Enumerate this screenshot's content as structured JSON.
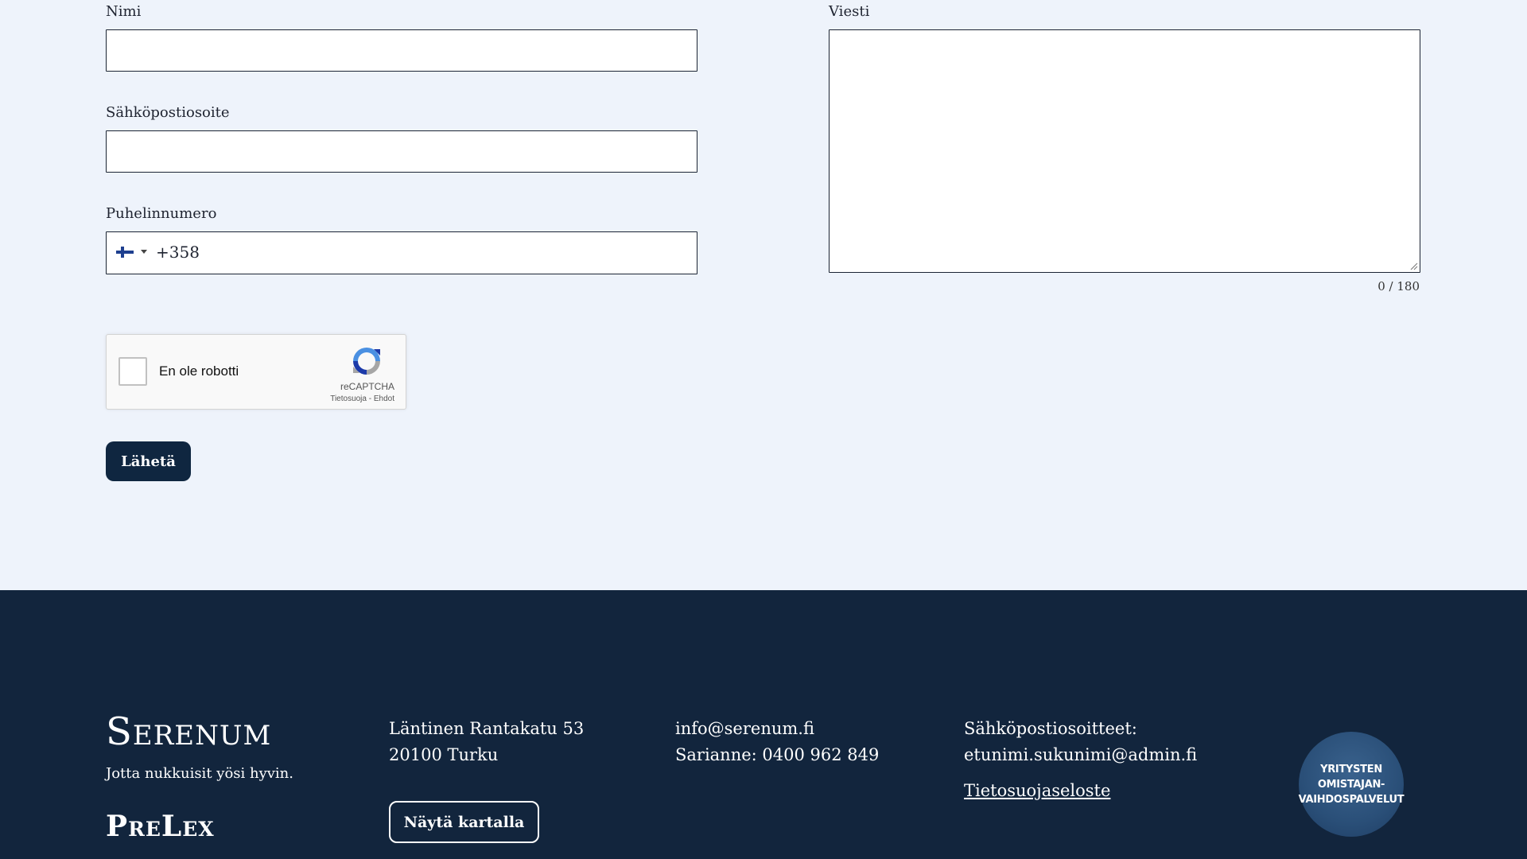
{
  "form": {
    "name_label": "Nimi",
    "email_label": "Sähköpostiosoite",
    "phone_label": "Puhelinnumero",
    "phone_prefix": "+358",
    "message_label": "Viesti",
    "char_counter": "0 / 180",
    "recaptcha": {
      "label": "En ole robotti",
      "brand": "reCAPTCHA",
      "links": "Tietosuoja - Ehdot"
    },
    "submit_label": "Lähetä"
  },
  "footer": {
    "logo_serenum": "Serenum",
    "tagline": "Jotta nukkuisit yösi hyvin.",
    "logo_prelex": "PreLex",
    "address_line1": "Läntinen Rantakatu 53",
    "address_line2": "20100 Turku",
    "map_button": "Näytä kartalla",
    "email": "info@serenum.fi",
    "phone": "Sarianne: 0400 962 849",
    "emails_heading": "Sähköpostiosoitteet:",
    "emails_format": "etunimi.sukunimi@admin.fi",
    "privacy_link": "Tietosuojaseloste",
    "badge_text": "YRITYSTEN\nOMISTAJAN-\nVAIHDOSPALVELUT"
  },
  "colors": {
    "page_bg": "#eef3fb",
    "footer_bg": "#12253d",
    "button_bg": "#0f2640",
    "flag_blue": "#1e3f8f"
  },
  "icons": {
    "flag": "finland-flag-icon",
    "dropdown": "caret-down-icon",
    "recaptcha": "recaptcha-logo-icon"
  }
}
